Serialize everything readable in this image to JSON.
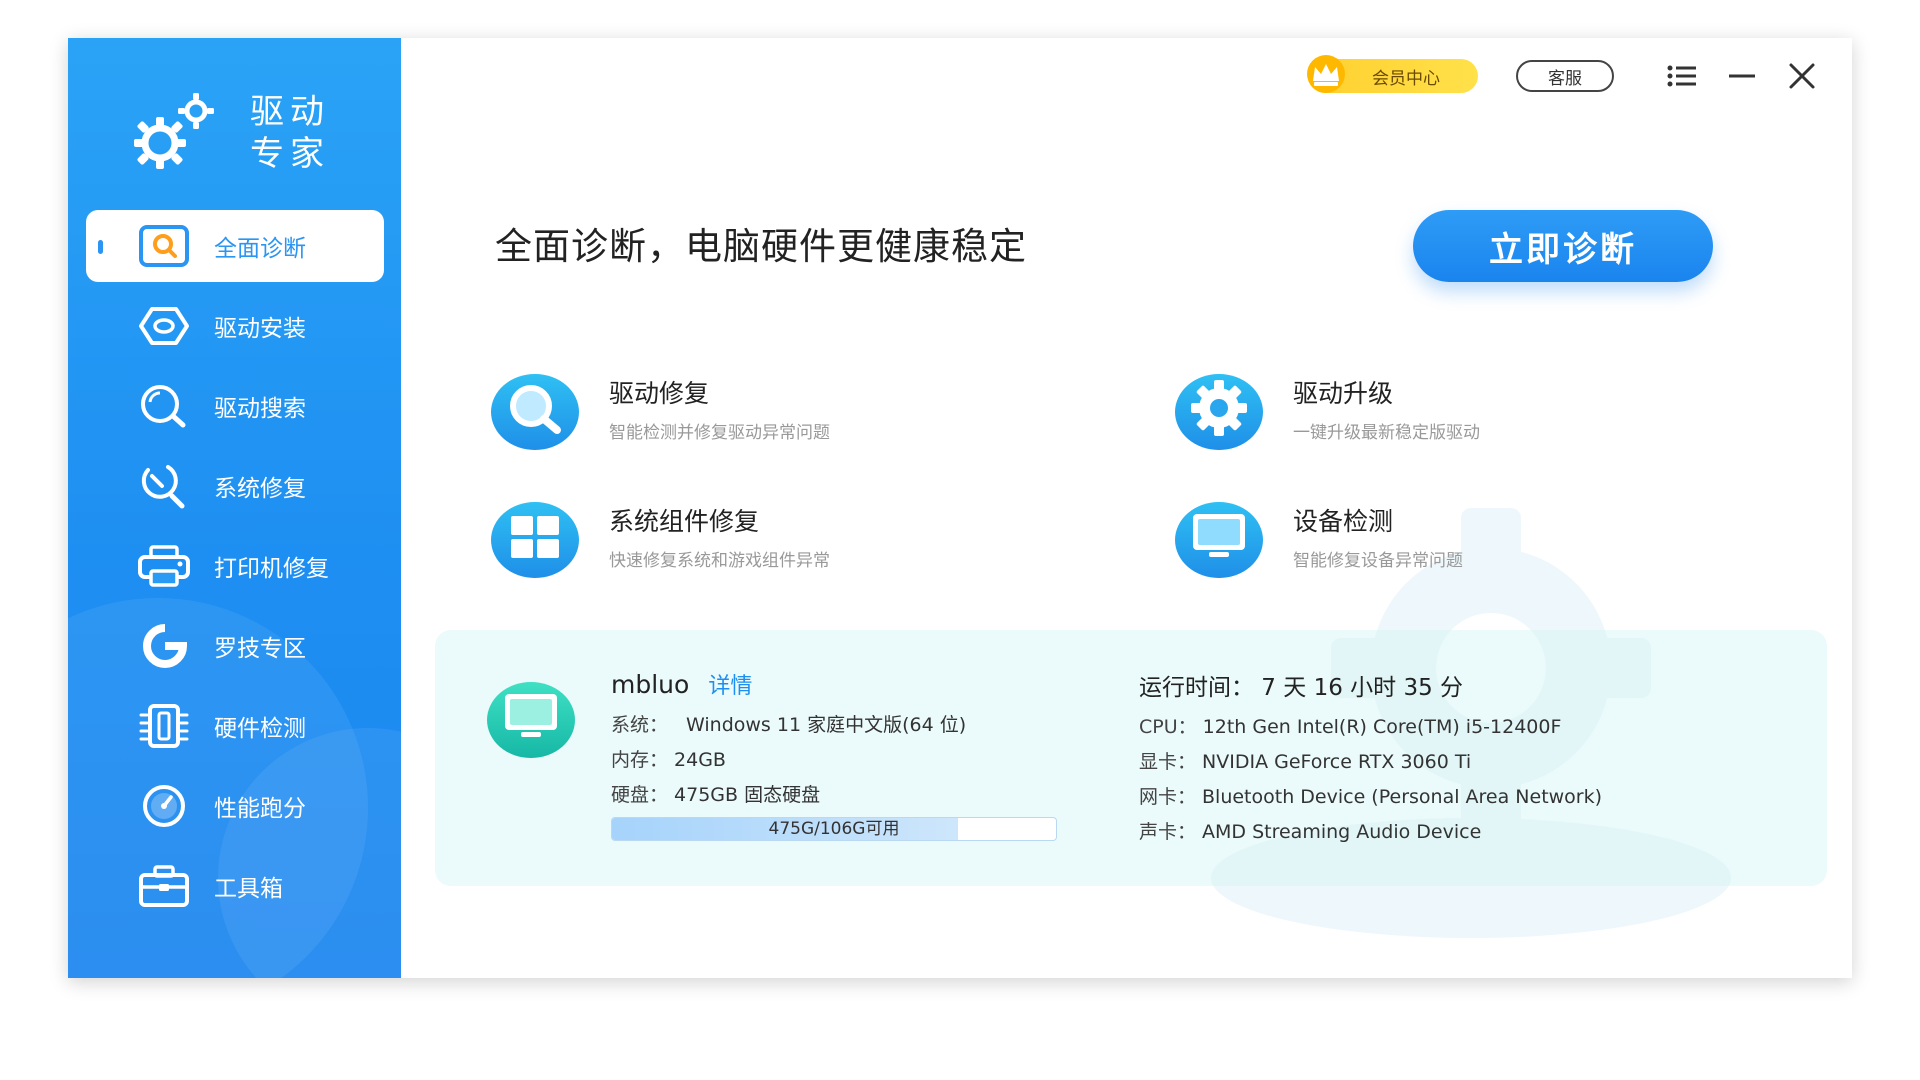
{
  "app": {
    "title_line1": "驱动",
    "title_line2": "专家"
  },
  "sidebar": {
    "items": [
      {
        "label": "全面诊断",
        "icon": "search-icon",
        "active": true
      },
      {
        "label": "驱动安装",
        "icon": "driver-install-icon",
        "active": false
      },
      {
        "label": "驱动搜索",
        "icon": "driver-search-icon",
        "active": false
      },
      {
        "label": "系统修复",
        "icon": "wrench-icon",
        "active": false
      },
      {
        "label": "打印机修复",
        "icon": "printer-icon",
        "active": false
      },
      {
        "label": "罗技专区",
        "icon": "logitech-icon",
        "active": false
      },
      {
        "label": "硬件检测",
        "icon": "hardware-icon",
        "active": false
      },
      {
        "label": "性能跑分",
        "icon": "gauge-icon",
        "active": false
      },
      {
        "label": "工具箱",
        "icon": "toolbox-icon",
        "active": false
      }
    ]
  },
  "topbar": {
    "vip_label": "会员中心",
    "service_label": "客服",
    "menu_icon": "menu-icon",
    "minimize_icon": "minimize-icon",
    "close_icon": "close-icon"
  },
  "main": {
    "headline": "全面诊断，电脑硬件更健康稳定",
    "diagnose_button": "立即诊断",
    "features": [
      {
        "title": "驱动修复",
        "desc": "智能检测并修复驱动异常问题",
        "icon": "magnifier-icon"
      },
      {
        "title": "驱动升级",
        "desc": "一键升级最新稳定版驱动",
        "icon": "gear-icon"
      },
      {
        "title": "系统组件修复",
        "desc": "快速修复系统和游戏组件异常",
        "icon": "windows-icon"
      },
      {
        "title": "设备检测",
        "desc": "智能修复设备异常问题",
        "icon": "monitor-icon"
      }
    ]
  },
  "system_info": {
    "username": "mbluo",
    "details_link": "详情",
    "os_label": "系统：",
    "os_value": "Windows 11 家庭中文版(64 位)",
    "ram_label": "内存：",
    "ram_value": "24GB",
    "disk_label": "硬盘：",
    "disk_value": "475GB 固态硬盘",
    "disk_bar_text": "475G/106G可用",
    "disk_used_fraction": 0.78,
    "uptime": "运行时间：  7 天 16 小时 35 分",
    "cpu_label": "CPU：",
    "cpu_value": "12th Gen Intel(R) Core(TM) i5-12400F",
    "gpu_label": "显卡：",
    "gpu_value": "NVIDIA GeForce RTX 3060 Ti",
    "nic_label": "网卡：",
    "nic_value": "Bluetooth Device (Personal Area Network)",
    "audio_label": "声卡：",
    "audio_value": "AMD Streaming Audio Device"
  },
  "colors": {
    "accent": "#1e8ff2",
    "sidebar_top": "#2aa3f6",
    "vip_gold": "#ffcf2e"
  }
}
